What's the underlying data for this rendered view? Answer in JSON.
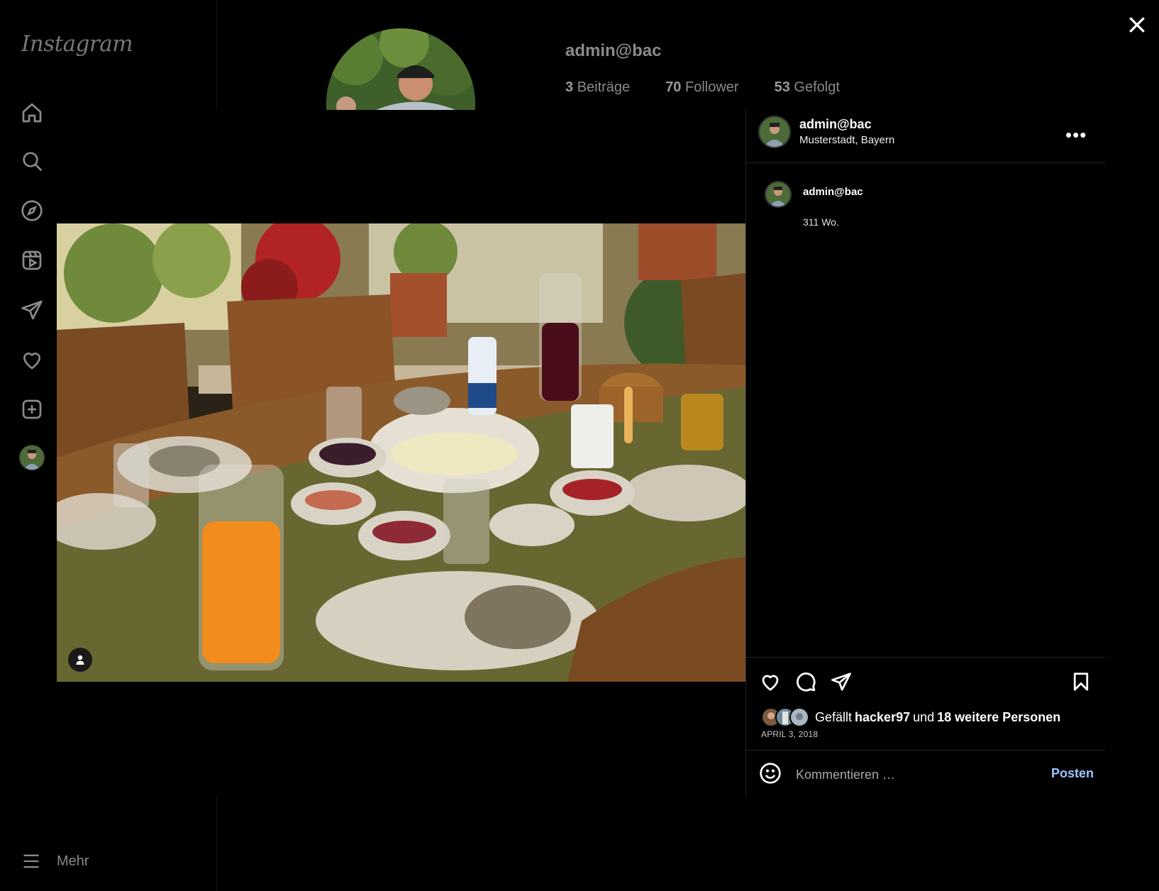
{
  "app": {
    "logo": "Instagram"
  },
  "sidebar": {
    "items": [
      {
        "icon": "home-icon"
      },
      {
        "icon": "search-icon"
      },
      {
        "icon": "explore-icon"
      },
      {
        "icon": "reels-icon"
      },
      {
        "icon": "messages-icon"
      },
      {
        "icon": "heart-icon"
      },
      {
        "icon": "create-icon"
      },
      {
        "icon": "profile-avatar"
      }
    ],
    "more_label": "Mehr"
  },
  "profile": {
    "username": "admin@bac",
    "posts_count": "3",
    "posts_label": "Beiträge",
    "followers_count": "70",
    "followers_label": "Follower",
    "following_count": "53",
    "following_label": "Gefolgt"
  },
  "post": {
    "author": "admin@bac",
    "location": "Musterstadt, Bayern",
    "caption_author": "admin@bac",
    "caption_time": "311 Wo.",
    "likes_prefix": "Gefällt",
    "likes_user": "hacker97",
    "likes_and": "und",
    "likes_others": "18 weitere Personen",
    "date": "APRIL 3, 2018",
    "comment_placeholder": "Kommentieren …",
    "post_button": "Posten"
  },
  "colors": {
    "accent": "#9ec4ff",
    "background": "#000000",
    "border": "#262626"
  }
}
